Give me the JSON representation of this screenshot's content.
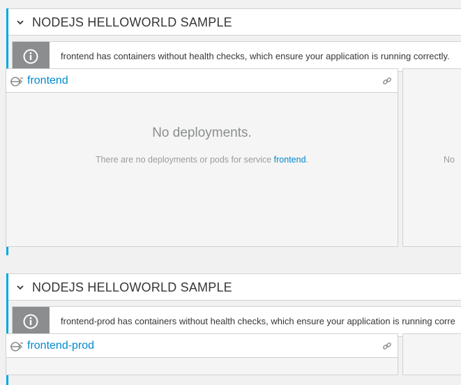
{
  "groups": [
    {
      "title": "NODEJS HELLOWORLD SAMPLE",
      "alert": "frontend has containers without health checks, which ensure your application is running correctly.",
      "service": {
        "name": "frontend",
        "empty_title": "No deployments.",
        "empty_sub_prefix": "There are no deployments or pods for service ",
        "empty_sub_link": "frontend",
        "empty_sub_suffix": "."
      },
      "side_clip": "No"
    },
    {
      "title": "NODEJS HELLOWORLD SAMPLE",
      "alert": "frontend-prod has containers without health checks, which ensure your application is running corre",
      "service": {
        "name": "frontend-prod"
      }
    }
  ],
  "icons": {
    "collapse": "chevron-down-icon",
    "info": "info-circle-icon",
    "service": "service-route-icon",
    "link": "link-icon"
  },
  "colors": {
    "accent": "#00a8e1",
    "link": "#0088ce",
    "alert_icon_bg": "#8b8d8f"
  }
}
